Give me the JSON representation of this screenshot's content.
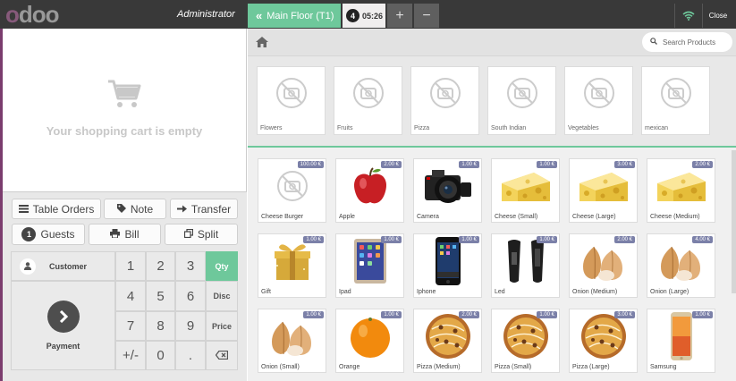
{
  "header": {
    "logo_first": "o",
    "logo_rest": "doo",
    "user": "Administrator",
    "floor_label": "Main Floor (T1)",
    "order_number": "4",
    "order_time": "05:26",
    "add_symbol": "+",
    "remove_symbol": "−",
    "close_label": "Close",
    "accent": "#6ec89b",
    "brand": "#875a7b"
  },
  "cart": {
    "empty_text": "Your shopping cart is empty"
  },
  "actions": {
    "table_orders": "Table Orders",
    "note": "Note",
    "transfer": "Transfer",
    "guests_count": "1",
    "guests": "Guests",
    "bill": "Bill",
    "split": "Split"
  },
  "numpad": {
    "customer": "Customer",
    "payment": "Payment",
    "keys": [
      "1",
      "2",
      "3",
      "4",
      "5",
      "6",
      "7",
      "8",
      "9",
      "+/-",
      "0",
      "."
    ],
    "qty": "Qty",
    "disc": "Disc",
    "price": "Price"
  },
  "search": {
    "placeholder": "Search Products"
  },
  "categories": [
    "Flowers",
    "Fruits",
    "Pizza",
    "South Indian",
    "Vegetables",
    "mexican"
  ],
  "products": [
    {
      "name": "Cheese Burger",
      "price": "100.00 €",
      "icon": "placeholder"
    },
    {
      "name": "Apple",
      "price": "2.00 €",
      "icon": "apple"
    },
    {
      "name": "Camera",
      "price": "1.00 €",
      "icon": "camera"
    },
    {
      "name": "Cheese (Small)",
      "price": "1.00 €",
      "icon": "cheese"
    },
    {
      "name": "Cheese (Large)",
      "price": "3.00 €",
      "icon": "cheese"
    },
    {
      "name": "Cheese (Medium)",
      "price": "2.00 €",
      "icon": "cheese"
    },
    {
      "name": "Gift",
      "price": "1.00 €",
      "icon": "gift"
    },
    {
      "name": "Ipad",
      "price": "1.00 €",
      "icon": "ipad"
    },
    {
      "name": "Iphone",
      "price": "1.00 €",
      "icon": "iphone"
    },
    {
      "name": "Led",
      "price": "1.00 €",
      "icon": "led"
    },
    {
      "name": "Onion (Medium)",
      "price": "2.00 €",
      "icon": "onion"
    },
    {
      "name": "Onion (Large)",
      "price": "4.00 €",
      "icon": "onion"
    },
    {
      "name": "Onion (Small)",
      "price": "1.00 €",
      "icon": "onion"
    },
    {
      "name": "Orange",
      "price": "1.00 €",
      "icon": "orange"
    },
    {
      "name": "Pizza (Medium)",
      "price": "2.00 €",
      "icon": "pizza"
    },
    {
      "name": "Pizza (Small)",
      "price": "1.00 €",
      "icon": "pizza"
    },
    {
      "name": "Pizza (Large)",
      "price": "3.00 €",
      "icon": "pizza"
    },
    {
      "name": "Samsung",
      "price": "1.00 €",
      "icon": "phone"
    }
  ]
}
